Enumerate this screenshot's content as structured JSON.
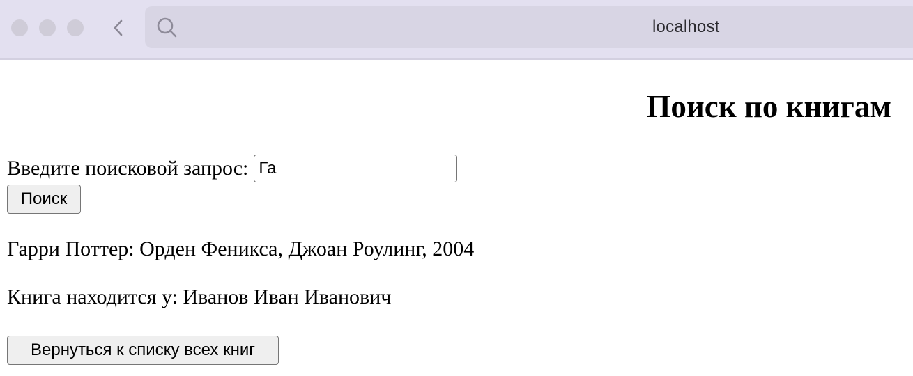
{
  "browser": {
    "url": "localhost",
    "icons": {
      "back": "chevron-left-icon",
      "search": "search-icon"
    }
  },
  "page": {
    "title": "Поиск по книгам",
    "search": {
      "label": "Введите поисковой запрос:",
      "value": "Га",
      "button_label": "Поиск"
    },
    "result": {
      "book": "Гарри Поттер: Орден Феникса, Джоан Роулинг, 2004",
      "holder": "Книга находится у: Иванов Иван Иванович"
    },
    "back_button_label": "Вернуться к списку всех книг"
  }
}
